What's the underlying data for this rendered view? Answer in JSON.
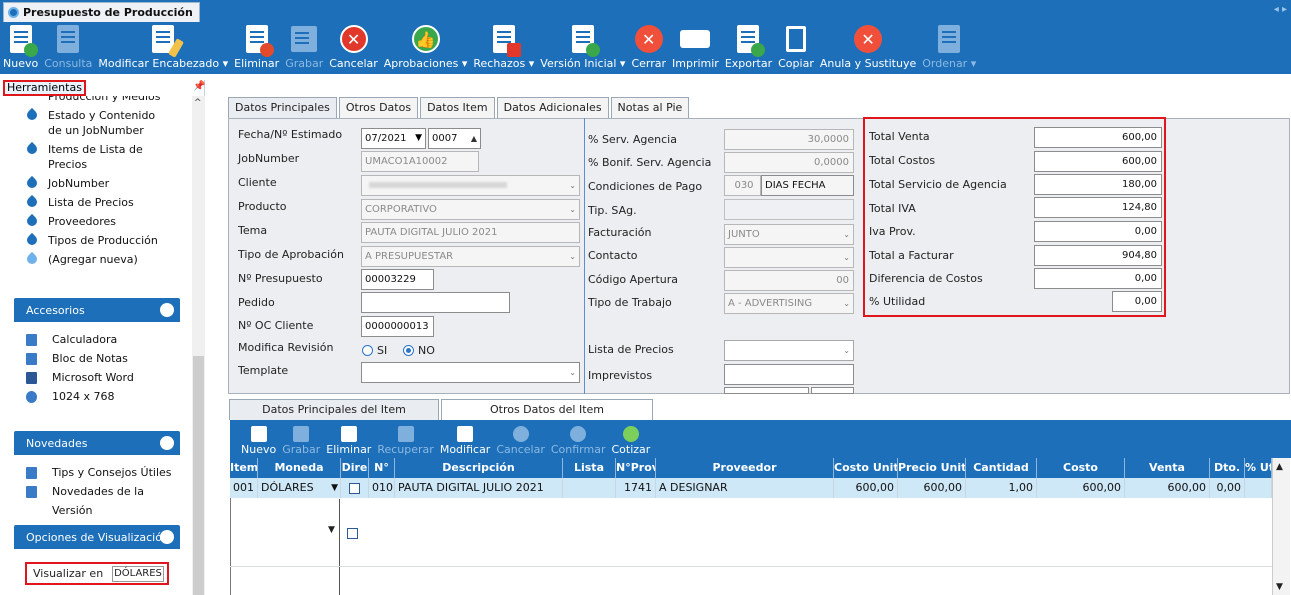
{
  "window": {
    "title": "Presupuesto de Producción"
  },
  "toolbar": [
    {
      "label": "Nuevo",
      "icon": "add-document-icon",
      "enabled": true
    },
    {
      "label": "Consulta",
      "icon": "query-document-icon",
      "enabled": false
    },
    {
      "label": "Modificar Encabezado ▾",
      "icon": "edit-document-icon",
      "enabled": true
    },
    {
      "label": "Eliminar",
      "icon": "delete-document-icon",
      "enabled": true
    },
    {
      "label": "Grabar",
      "icon": "save-icon",
      "enabled": false
    },
    {
      "label": "Cancelar",
      "icon": "cancel-icon",
      "enabled": true
    },
    {
      "label": "Aprobaciones ▾",
      "icon": "thumbs-up-icon",
      "enabled": true
    },
    {
      "label": "Rechazos ▾",
      "icon": "reject-document-icon",
      "enabled": true
    },
    {
      "label": "Versión Inicial ▾",
      "icon": "version-document-icon",
      "enabled": true
    },
    {
      "label": "Cerrar",
      "icon": "close-icon",
      "enabled": true
    },
    {
      "label": "Imprimir",
      "icon": "printer-icon",
      "enabled": true
    },
    {
      "label": "Exportar",
      "icon": "export-icon",
      "enabled": true
    },
    {
      "label": "Copiar",
      "icon": "copy-icon",
      "enabled": true
    },
    {
      "label": "Anula y Sustituye",
      "icon": "void-replace-icon",
      "enabled": true
    },
    {
      "label": "Ordenar ▾",
      "icon": "order-document-icon",
      "enabled": false
    }
  ],
  "sidebar": {
    "herramientas_title": "Herramientas",
    "tools": [
      "Producción y Medios",
      "Estado y Contenido de un JobNumber",
      "Items de Lista de Precios",
      "JobNumber",
      "Lista de Precios",
      "Proveedores",
      "Tipos de Producción",
      "(Agregar nueva)"
    ],
    "accesorios_title": "Accesorios",
    "accesorios": [
      "Calculadora",
      "Bloc de Notas",
      "Microsoft Word",
      "1024 x 768"
    ],
    "novedades_title": "Novedades",
    "novedades": [
      "Tips y Consejos Útiles",
      "Novedades de la Versión"
    ],
    "opciones_title": "Opciones de Visualización",
    "visualizar_label": "Visualizar en",
    "visualizar_value": "DÓLARES"
  },
  "main_tabs": [
    "Datos Principales",
    "Otros Datos",
    "Datos Item",
    "Datos Adicionales",
    "Notas al Pie"
  ],
  "form": {
    "fecha_label": "Fecha/Nº Estimado",
    "fecha_value": "07/2021",
    "estimado_value": "0007",
    "jobnumber_label": "JobNumber",
    "jobnumber_value": "UMACO1A10002",
    "cliente_label": "Cliente",
    "cliente_value": "",
    "producto_label": "Producto",
    "producto_value": "CORPORATIVO",
    "tema_label": "Tema",
    "tema_value": "PAUTA DIGITAL JULIO 2021",
    "tipo_aprob_label": "Tipo de Aprobación",
    "tipo_aprob_value": "A PRESUPUESTAR",
    "num_presup_label": "Nº Presupuesto",
    "num_presup_value": "00003229",
    "pedido_label": "Pedido",
    "pedido_value": "",
    "oc_label": "Nº OC Cliente",
    "oc_value": "0000000013",
    "modifica_label": "Modifica Revisión",
    "si_label": "SI",
    "no_label": "NO",
    "template_label": "Template",
    "template_value": ""
  },
  "form2": {
    "serv_agencia_label": "% Serv. Agencia",
    "serv_agencia_value": "30,0000",
    "bonif_label": "% Bonif. Serv. Agencia",
    "bonif_value": "0,0000",
    "cond_pago_label": "Condiciones de Pago",
    "cond_pago_code": "030",
    "cond_pago_value": "DIAS FECHA",
    "tip_sag_label": "Tip. SAg.",
    "facturacion_label": "Facturación",
    "facturacion_value": "JUNTO",
    "contacto_label": "Contacto",
    "codigo_label": "Código Apertura",
    "codigo_value": "00",
    "tipo_trabajo_label": "Tipo de Trabajo",
    "tipo_trabajo_value": "A - ADVERTISING",
    "lista_precios_label": "Lista de Precios",
    "imprevistos_label": "Imprevistos"
  },
  "totals": [
    {
      "label": "Total Venta",
      "value": "600,00"
    },
    {
      "label": "Total Costos",
      "value": "600,00"
    },
    {
      "label": "Total Servicio de Agencia",
      "value": "180,00"
    },
    {
      "label": "Total IVA",
      "value": "124,80"
    },
    {
      "label": "Iva Prov.",
      "value": "0,00"
    },
    {
      "label": "Total a Facturar",
      "value": "904,80"
    },
    {
      "label": "Diferencia de Costos",
      "value": "0,00"
    },
    {
      "label": "% Utilidad",
      "value": "0,00"
    }
  ],
  "item_tabs": [
    "Datos Principales del Item",
    "Otros Datos del Item"
  ],
  "item_toolbar": [
    {
      "label": "Nuevo",
      "enabled": true
    },
    {
      "label": "Grabar",
      "enabled": false
    },
    {
      "label": "Eliminar",
      "enabled": true
    },
    {
      "label": "Recuperar",
      "enabled": false
    },
    {
      "label": "Modificar",
      "enabled": true
    },
    {
      "label": "Cancelar",
      "enabled": false
    },
    {
      "label": "Confirmar",
      "enabled": false
    },
    {
      "label": "Cotizar",
      "enabled": true
    }
  ],
  "grid": {
    "columns": [
      "Item",
      "Moneda",
      "Dire",
      "N°",
      "Descripción",
      "Lista",
      "N°Prov",
      "Proveedor",
      "Costo Unit.",
      "Precio Unit.",
      "Cantidad",
      "Costo",
      "Venta",
      "Dto.",
      "% Ut"
    ],
    "rows": [
      {
        "item": "001",
        "moneda": "DÓLARES",
        "n": "010",
        "descripcion": "PAUTA DIGITAL JULIO 2021",
        "lista": "",
        "nprov": "1741",
        "proveedor": "A DESIGNAR",
        "costo_unit": "600,00",
        "precio_unit": "600,00",
        "cantidad": "1,00",
        "costo": "600,00",
        "venta": "600,00",
        "dto": "0,00",
        "ut": ""
      }
    ]
  },
  "colors": {
    "primary": "#1c6fb8",
    "highlight": "#e0161d",
    "row_selected": "#cfe8f8"
  }
}
